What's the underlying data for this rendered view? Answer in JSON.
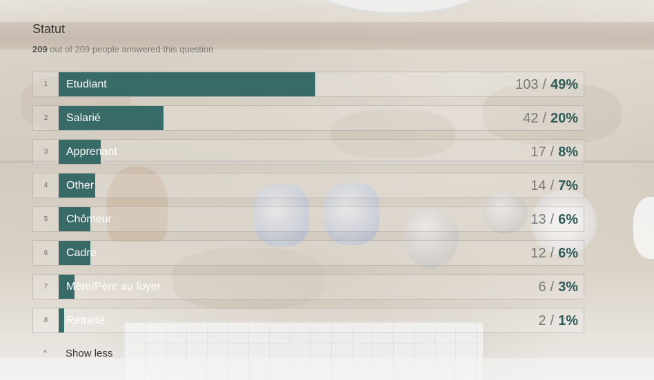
{
  "question": {
    "title": "Statut",
    "answered_count": "209",
    "answered_suffix": "out of 209 people answered this question"
  },
  "colors": {
    "bar": "#386b68",
    "percent": "#2f5b59"
  },
  "chart_data": {
    "type": "bar",
    "categories": [
      "Etudiant",
      "Salarié",
      "Apprenant",
      "Other",
      "Chômeur",
      "Cadre",
      "Mère/Père au foyer",
      "Retraité"
    ],
    "values": [
      103,
      42,
      17,
      14,
      13,
      12,
      6,
      2
    ],
    "percent": [
      49,
      20,
      8,
      7,
      6,
      6,
      3,
      1
    ]
  },
  "rows": [
    {
      "rank": "1",
      "label": "Etudiant",
      "count": "103",
      "sep": "/",
      "percent_text": "49%"
    },
    {
      "rank": "2",
      "label": "Salarié",
      "count": "42",
      "sep": "/",
      "percent_text": "20%"
    },
    {
      "rank": "3",
      "label": "Apprenant",
      "count": "17",
      "sep": "/",
      "percent_text": "8%"
    },
    {
      "rank": "4",
      "label": "Other",
      "count": "14",
      "sep": "/",
      "percent_text": "7%"
    },
    {
      "rank": "5",
      "label": "Chômeur",
      "count": "13",
      "sep": "/",
      "percent_text": "6%"
    },
    {
      "rank": "6",
      "label": "Cadre",
      "count": "12",
      "sep": "/",
      "percent_text": "6%"
    },
    {
      "rank": "7",
      "label": "Mère/Père au foyer",
      "count": "6",
      "sep": "/",
      "percent_text": "3%"
    },
    {
      "rank": "8",
      "label": "Retraité",
      "count": "2",
      "sep": "/",
      "percent_text": "1%"
    }
  ],
  "show_less": {
    "icon": "chevron-up-icon",
    "glyph": "^",
    "label": "Show less"
  }
}
